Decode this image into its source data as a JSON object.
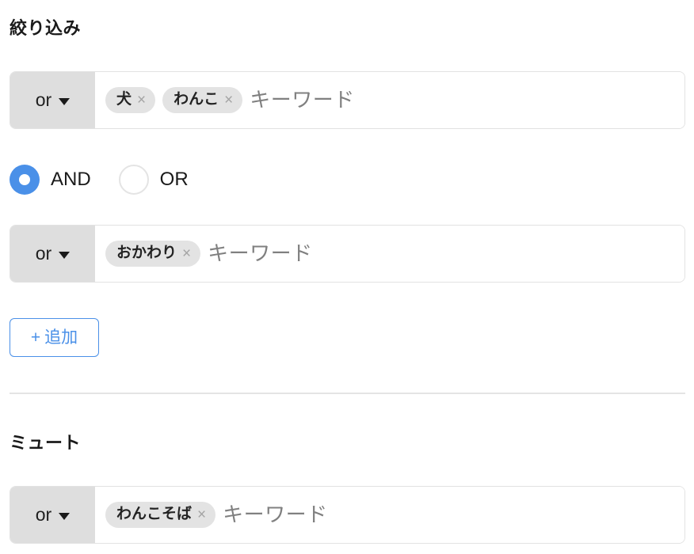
{
  "filter": {
    "title": "絞り込み",
    "rows": [
      {
        "operator": "or",
        "placeholder": "キーワード",
        "tags": [
          "犬",
          "わんこ"
        ]
      },
      {
        "operator": "or",
        "placeholder": "キーワード",
        "tags": [
          "おかわり"
        ]
      }
    ],
    "join": {
      "selected": "AND",
      "options": [
        {
          "label": "AND",
          "selected": true
        },
        {
          "label": "OR",
          "selected": false
        }
      ]
    },
    "add_button": {
      "plus": "+",
      "label": "追加"
    }
  },
  "mute": {
    "title": "ミュート",
    "rows": [
      {
        "operator": "or",
        "placeholder": "キーワード",
        "tags": [
          "わんこそば"
        ]
      }
    ]
  },
  "icons": {
    "tag_remove": "×",
    "caret_down": "chevron-down-icon"
  },
  "colors": {
    "accent": "#4a90e8",
    "operator_background": "#dedede",
    "tag_background": "#e3e3e3",
    "border": "#e2e2e2",
    "placeholder_text": "#808080",
    "divider": "#e4e4e4"
  }
}
